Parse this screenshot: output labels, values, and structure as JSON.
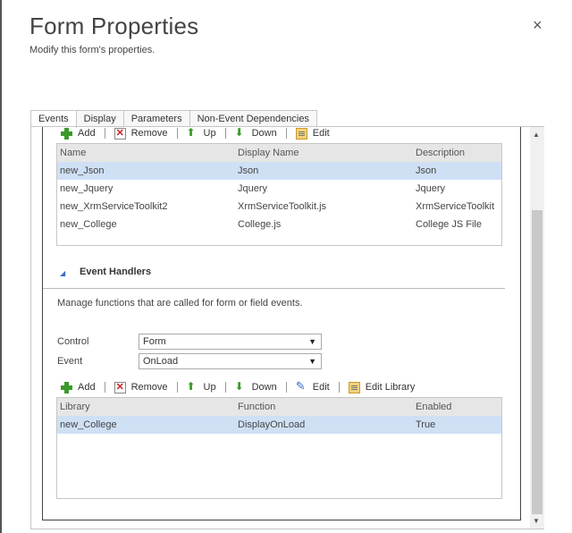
{
  "dialog": {
    "title": "Form Properties",
    "subtitle": "Modify this form's properties.",
    "close_glyph": "×"
  },
  "tabs": [
    "Events",
    "Display",
    "Parameters",
    "Non-Event Dependencies"
  ],
  "library_toolbar": {
    "add": "Add",
    "remove": "Remove",
    "up": "Up",
    "down": "Down",
    "edit": "Edit"
  },
  "library_grid": {
    "columns": [
      "Name",
      "Display Name",
      "Description"
    ],
    "rows": [
      [
        "new_Json",
        "Json",
        "Json"
      ],
      [
        "new_Jquery",
        "Jquery",
        "Jquery"
      ],
      [
        "new_XrmServiceToolkit2",
        "XrmServiceToolkit.js",
        "XrmServiceToolkit"
      ],
      [
        "new_College",
        "College.js",
        "College JS File"
      ]
    ]
  },
  "event_handlers": {
    "title": "Event Handlers",
    "description": "Manage functions that are called for form or field events.",
    "control_label": "Control",
    "control_value": "Form",
    "event_label": "Event",
    "event_value": "OnLoad"
  },
  "handler_toolbar": {
    "add": "Add",
    "remove": "Remove",
    "up": "Up",
    "down": "Down",
    "edit": "Edit",
    "edit_library": "Edit Library"
  },
  "handler_grid": {
    "columns": [
      "Library",
      "Function",
      "Enabled"
    ],
    "rows": [
      [
        "new_College",
        "DisplayOnLoad",
        "True"
      ]
    ]
  },
  "colors": {
    "selected_row": "#cfe0f5",
    "header_bg": "#e6e6e6",
    "accent_green": "#3a9a2a"
  }
}
